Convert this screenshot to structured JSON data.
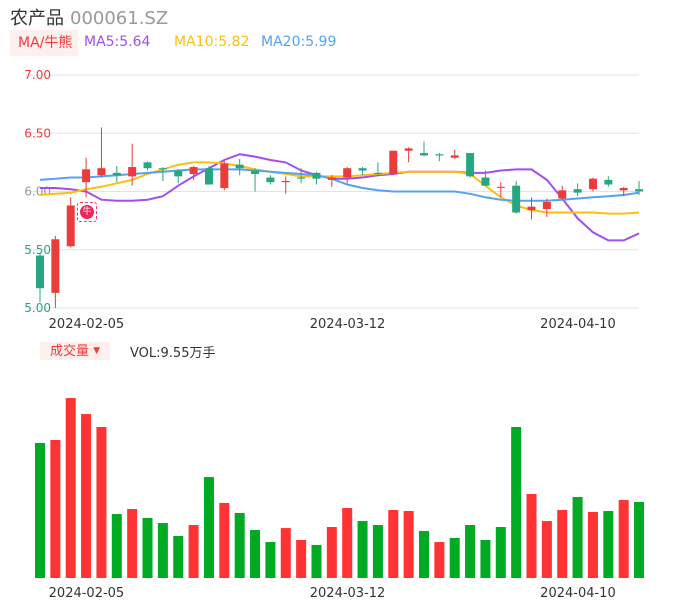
{
  "header": {
    "name": "农产品",
    "code": "000061.SZ"
  },
  "ma_legend": {
    "button": "MA/牛熊",
    "ma5": "MA5:5.64",
    "ma10": "MA10:5.82",
    "ma20": "MA20:5.99"
  },
  "volume_legend": {
    "button": "成交量",
    "vol": "VOL:9.55万手"
  },
  "badge": "牛",
  "colors": {
    "up": "#ec3b3b",
    "down": "#27a682",
    "ma5": "#a24ef0",
    "ma10": "#fdbf0f",
    "ma20": "#54a3f2",
    "vol_up": "#ff3333",
    "vol_down": "#00aa22"
  },
  "chart_data": [
    {
      "type": "candlestick",
      "title": "农产品 000061.SZ",
      "ylim": [
        5.0,
        7.0
      ],
      "yticks": [
        "7.00",
        "6.50",
        "6.00",
        "5.50",
        "5.00"
      ],
      "xticks": [
        {
          "index": 4,
          "label": "2024-02-05"
        },
        {
          "index": 21,
          "label": "2024-03-12"
        },
        {
          "index": 36,
          "label": "2024-04-10"
        }
      ],
      "ohlc": [
        [
          5.45,
          5.47,
          5.05,
          5.17
        ],
        [
          5.13,
          5.62,
          5.0,
          5.59
        ],
        [
          5.53,
          5.95,
          5.52,
          5.88
        ],
        [
          6.08,
          6.29,
          5.95,
          6.19
        ],
        [
          6.14,
          6.55,
          6.12,
          6.2
        ],
        [
          6.16,
          6.22,
          6.08,
          6.14
        ],
        [
          6.13,
          6.41,
          6.05,
          6.21
        ],
        [
          6.25,
          6.26,
          6.18,
          6.2
        ],
        [
          6.2,
          6.21,
          6.09,
          6.19
        ],
        [
          6.18,
          6.19,
          6.07,
          6.13
        ],
        [
          6.15,
          6.22,
          6.1,
          6.21
        ],
        [
          6.2,
          6.22,
          6.06,
          6.06
        ],
        [
          6.03,
          6.26,
          6.01,
          6.24
        ],
        [
          6.23,
          6.28,
          6.14,
          6.2
        ],
        [
          6.18,
          6.2,
          6.0,
          6.15
        ],
        [
          6.12,
          6.14,
          6.06,
          6.08
        ],
        [
          6.08,
          6.13,
          5.98,
          6.09
        ],
        [
          6.12,
          6.2,
          6.07,
          6.11
        ],
        [
          6.16,
          6.17,
          6.06,
          6.11
        ],
        [
          6.1,
          6.14,
          6.04,
          6.12
        ],
        [
          6.12,
          6.21,
          6.07,
          6.2
        ],
        [
          6.2,
          6.21,
          6.14,
          6.18
        ],
        [
          6.16,
          6.25,
          6.13,
          6.15
        ],
        [
          6.15,
          6.35,
          6.14,
          6.35
        ],
        [
          6.35,
          6.38,
          6.25,
          6.37
        ],
        [
          6.33,
          6.43,
          6.3,
          6.31
        ],
        [
          6.32,
          6.33,
          6.26,
          6.31
        ],
        [
          6.29,
          6.36,
          6.28,
          6.31
        ],
        [
          6.33,
          6.33,
          6.12,
          6.13
        ],
        [
          6.12,
          6.18,
          6.05,
          6.05
        ],
        [
          6.04,
          6.08,
          5.95,
          6.04
        ],
        [
          6.05,
          6.09,
          5.81,
          5.82
        ],
        [
          5.84,
          5.95,
          5.76,
          5.87
        ],
        [
          5.85,
          5.94,
          5.78,
          5.91
        ],
        [
          5.94,
          6.05,
          5.93,
          6.01
        ],
        [
          6.02,
          6.07,
          5.96,
          5.99
        ],
        [
          6.02,
          6.12,
          6.0,
          6.11
        ],
        [
          6.1,
          6.13,
          6.04,
          6.06
        ],
        [
          6.01,
          6.04,
          5.96,
          6.03
        ],
        [
          6.02,
          6.09,
          5.97,
          6.0
        ]
      ],
      "series": [
        {
          "name": "MA5",
          "values": [
            6.03,
            6.03,
            6.02,
            6.0,
            5.93,
            5.92,
            5.92,
            5.93,
            5.96,
            6.05,
            6.13,
            6.2,
            6.27,
            6.32,
            6.3,
            6.27,
            6.25,
            6.18,
            6.14,
            6.11,
            6.11,
            6.12,
            6.14,
            6.15,
            6.17,
            6.17,
            6.17,
            6.17,
            6.16,
            6.16,
            6.18,
            6.19,
            6.19,
            6.1,
            5.94,
            5.77,
            5.65,
            5.58,
            5.58,
            5.64
          ]
        },
        {
          "name": "MA10",
          "values": [
            5.97,
            5.98,
            5.99,
            6.02,
            6.04,
            6.07,
            6.1,
            6.15,
            6.19,
            6.23,
            6.25,
            6.25,
            6.24,
            6.22,
            6.19,
            6.17,
            6.15,
            6.13,
            6.13,
            6.13,
            6.13,
            6.14,
            6.15,
            6.16,
            6.17,
            6.17,
            6.17,
            6.17,
            6.15,
            6.05,
            5.95,
            5.88,
            5.84,
            5.82,
            5.82,
            5.82,
            5.82,
            5.81,
            5.81,
            5.82
          ]
        },
        {
          "name": "MA20",
          "values": [
            6.1,
            6.11,
            6.12,
            6.12,
            6.13,
            6.14,
            6.15,
            6.16,
            6.17,
            6.18,
            6.19,
            6.19,
            6.19,
            6.19,
            6.18,
            6.17,
            6.16,
            6.15,
            6.14,
            6.11,
            6.06,
            6.03,
            6.01,
            6.0,
            6.0,
            6.0,
            6.0,
            6.0,
            5.98,
            5.95,
            5.93,
            5.92,
            5.92,
            5.92,
            5.93,
            5.94,
            5.95,
            5.96,
            5.97,
            5.99
          ]
        }
      ]
    },
    {
      "type": "bar",
      "title": "成交量",
      "ylabel": "万手",
      "values": [
        16.97,
        17.35,
        22.62,
        20.61,
        18.98,
        8.04,
        8.67,
        7.54,
        6.91,
        5.28,
        6.66,
        12.69,
        9.43,
        8.17,
        6.03,
        4.52,
        6.28,
        4.78,
        4.15,
        6.41,
        8.8,
        7.16,
        6.66,
        8.55,
        8.42,
        5.91,
        4.52,
        5.03,
        6.66,
        4.78,
        6.41,
        18.98,
        10.56,
        7.16,
        8.55,
        10.18,
        8.3,
        8.42,
        9.8,
        9.55
      ],
      "up": [
        0,
        1,
        1,
        1,
        1,
        0,
        1,
        0,
        0,
        0,
        1,
        0,
        1,
        0,
        0,
        0,
        1,
        1,
        0,
        1,
        1,
        0,
        0,
        1,
        1,
        0,
        1,
        0,
        0,
        0,
        0,
        0,
        1,
        1,
        1,
        0,
        1,
        0,
        1,
        0
      ],
      "xticks": [
        {
          "index": 4,
          "label": "2024-02-05"
        },
        {
          "index": 21,
          "label": "2024-03-12"
        },
        {
          "index": 36,
          "label": "2024-04-10"
        }
      ]
    }
  ]
}
